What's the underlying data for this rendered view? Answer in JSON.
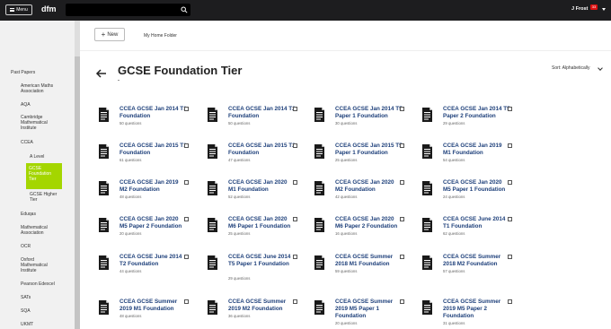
{
  "topbar": {
    "menu_label": "Menu",
    "logo": "dfm",
    "search_placeholder": "",
    "user_name": "J Frost",
    "user_badge": "33"
  },
  "toolbar": {
    "new_label": "New",
    "home_folder_label": "My Home Folder"
  },
  "sidebar": {
    "items": [
      {
        "label": "Past Papers"
      },
      {
        "label": "American Maths Association"
      },
      {
        "label": "AQA"
      },
      {
        "label": "Cambridge Mathematical Institute"
      },
      {
        "label": "CCEA"
      },
      {
        "label": "A Level"
      },
      {
        "label": "GCSE Foundation Tier"
      },
      {
        "label": "GCSE Higher Tier"
      },
      {
        "label": "Eduqas"
      },
      {
        "label": "Mathematical Association"
      },
      {
        "label": "OCR"
      },
      {
        "label": "Oxford Mathematical Institute"
      },
      {
        "label": "Pearson Edexcel"
      },
      {
        "label": "SATs"
      },
      {
        "label": "SQA"
      },
      {
        "label": "UKMT"
      }
    ]
  },
  "page": {
    "title": "GCSE Foundation Tier",
    "sort_label": "Sort: Alphabetically"
  },
  "cards": [
    {
      "title": "CCEA GCSE Jan 2014 T1 Foundation",
      "count": "50 questions"
    },
    {
      "title": "CCEA GCSE Jan 2014 T2 Foundation",
      "count": "50 questions"
    },
    {
      "title": "CCEA GCSE Jan 2014 T5 Paper 1 Foundation",
      "count": "30 questions"
    },
    {
      "title": "CCEA GCSE Jan 2014 T5 Paper 2 Foundation",
      "count": "29 questions"
    },
    {
      "title": "CCEA GCSE Jan 2015 T1 Foundation",
      "count": "61 questions"
    },
    {
      "title": "CCEA GCSE Jan 2015 T2 Foundation",
      "count": "47 questions"
    },
    {
      "title": "CCEA GCSE Jan 2015 T5 Paper 1 Foundation",
      "count": "25 questions"
    },
    {
      "title": "CCEA GCSE Jan 2019 M1 Foundation",
      "count": "54 questions"
    },
    {
      "title": "CCEA GCSE Jan 2019 M2 Foundation",
      "count": "48 questions"
    },
    {
      "title": "CCEA GCSE Jan 2020 M1 Foundation",
      "count": "52 questions"
    },
    {
      "title": "CCEA GCSE Jan 2020 M2 Foundation",
      "count": "42 questions"
    },
    {
      "title": "CCEA GCSE Jan 2020 M5 Paper 1 Foundation",
      "count": "24 questions"
    },
    {
      "title": "CCEA GCSE Jan 2020 M5 Paper 2 Foundation",
      "count": "20 questions"
    },
    {
      "title": "CCEA GCSE Jan 2020 M6 Paper 1 Foundation",
      "count": "25 questions"
    },
    {
      "title": "CCEA GCSE Jan 2020 M6 Paper 2 Foundation",
      "count": "16 questions"
    },
    {
      "title": "CCEA GCSE June 2014 T1 Foundation",
      "count": "62 questions"
    },
    {
      "title": "CCEA GCSE June 2014 T2 Foundation",
      "count": "44 questions"
    },
    {
      "title": "CCEA GCSE June 2014 T5 Paper 1 Foundation",
      "count": "29 questions"
    },
    {
      "title": "CCEA GCSE Summer 2018 M1 Foundation",
      "count": "59 questions"
    },
    {
      "title": "CCEA GCSE Summer 2018 M2 Foundation",
      "count": "57 questions"
    },
    {
      "title": "CCEA GCSE Summer 2019 M1 Foundation",
      "count": "48 questions"
    },
    {
      "title": "CCEA GCSE Summer 2019 M2 Foundation",
      "count": "36 questions"
    },
    {
      "title": "CCEA GCSE Summer 2019 M5 Paper 1 Foundation",
      "count": "20 questions"
    },
    {
      "title": "CCEA GCSE Summer 2019 M5 Paper 2 Foundation",
      "count": "31 questions"
    }
  ]
}
